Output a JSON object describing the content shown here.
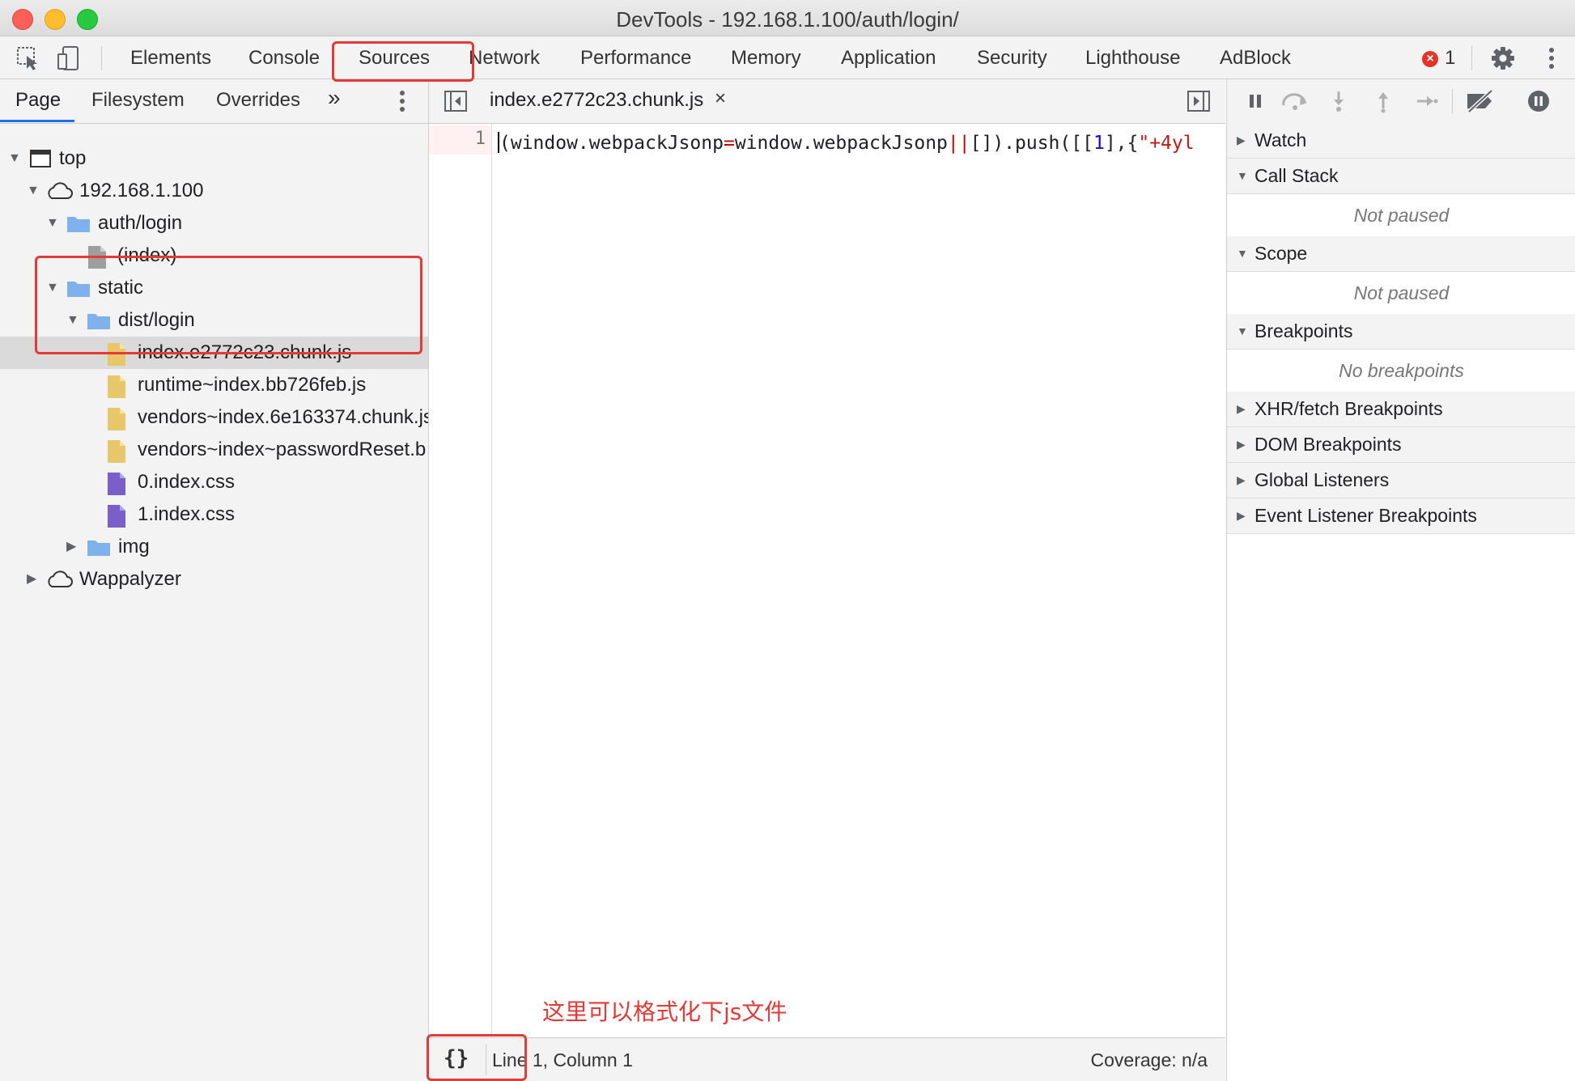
{
  "window": {
    "title": "DevTools - 192.168.1.100/auth/login/"
  },
  "main_tabs": [
    "Elements",
    "Console",
    "Sources",
    "Network",
    "Performance",
    "Memory",
    "Application",
    "Security",
    "Lighthouse",
    "AdBlock"
  ],
  "active_main_tab": "Sources",
  "error_count": "1",
  "navigator": {
    "tabs": [
      "Page",
      "Filesystem",
      "Overrides"
    ],
    "more": "»",
    "tree": {
      "top": "top",
      "host": "192.168.1.100",
      "auth_login": "auth/login",
      "index": "(index)",
      "static": "static",
      "dist_login": "dist/login",
      "files": [
        "index.e2772c23.chunk.js",
        "runtime~index.bb726feb.js",
        "vendors~index.6e163374.chunk.js",
        "vendors~index~passwordReset.b",
        "0.index.css",
        "1.index.css"
      ],
      "img": "img",
      "wappalyzer": "Wappalyzer"
    }
  },
  "editor": {
    "open_file": "index.e2772c23.chunk.js",
    "close_glyph": "×",
    "line_number": "1",
    "code": {
      "a": "(window.webpackJsonp",
      "eq": "=",
      "b": "window.webpackJsonp",
      "or": "||",
      "c": "[]).push([[",
      "num": "1",
      "d": "],{",
      "str": "\"+4yl"
    },
    "annotation": "这里可以格式化下js文件",
    "status": {
      "pretty_print": "{}",
      "position": "Line 1, Column 1",
      "coverage": "Coverage: n/a"
    }
  },
  "debugger": {
    "panes": [
      {
        "title": "Watch",
        "expanded": false
      },
      {
        "title": "Call Stack",
        "expanded": true,
        "body": "Not paused"
      },
      {
        "title": "Scope",
        "expanded": true,
        "body": "Not paused"
      },
      {
        "title": "Breakpoints",
        "expanded": true,
        "body": "No breakpoints"
      },
      {
        "title": "XHR/fetch Breakpoints",
        "expanded": false
      },
      {
        "title": "DOM Breakpoints",
        "expanded": false
      },
      {
        "title": "Global Listeners",
        "expanded": false
      },
      {
        "title": "Event Listener Breakpoints",
        "expanded": false
      }
    ]
  },
  "colors": {
    "highlight_box": "#e53935",
    "folder": "#7fb2ec",
    "js_file": "#e8c76a",
    "css_file": "#7a5fc8",
    "doc_file": "#9e9e9e"
  }
}
